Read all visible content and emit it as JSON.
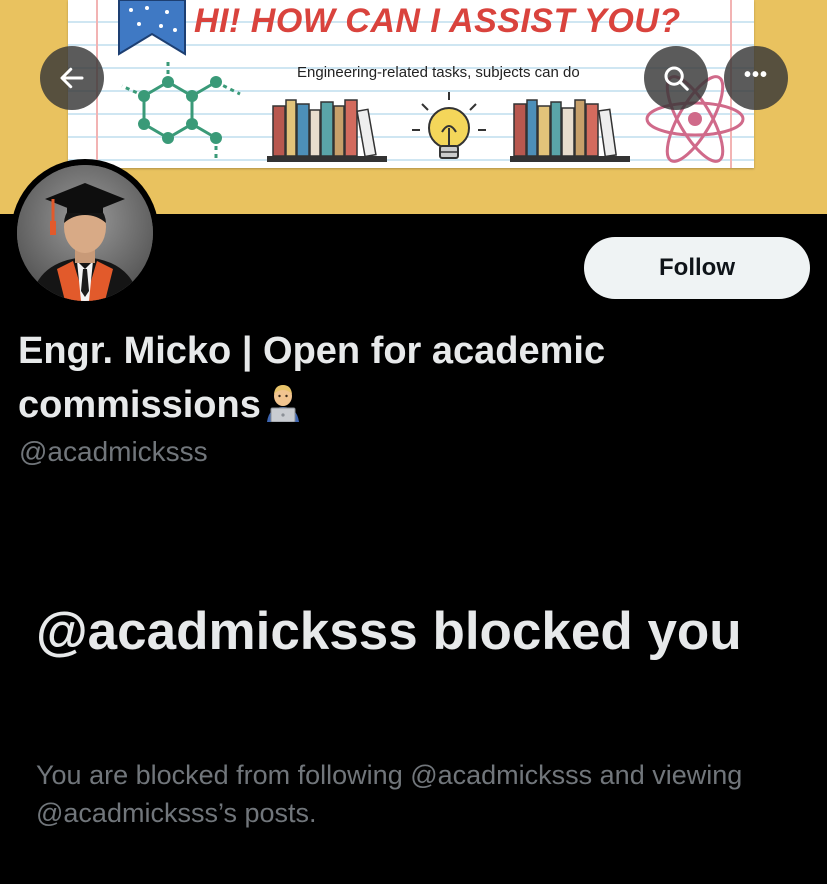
{
  "banner": {
    "headline": "HI! HOW CAN I ASSIST YOU?",
    "subtitle": "Engineering-related tasks, subjects can do"
  },
  "top_bar": {
    "back_icon": "arrow-left-icon",
    "search_icon": "search-icon",
    "more_icon": "more-horizontal-icon",
    "more_label": "•••"
  },
  "profile": {
    "display_name": "Engr. Micko | Open for academic commissions",
    "name_emoji": "technologist-emoji",
    "handle": "@acadmicksss",
    "follow_label": "Follow"
  },
  "blocked": {
    "title": "@acadmicksss blocked you",
    "description": "You are blocked from following @acadmicksss and viewing @acadmicksss’s posts."
  },
  "colors": {
    "background": "#000000",
    "primary_text": "#e7e9ea",
    "secondary_text": "#71767b",
    "follow_button_bg": "#eff3f4",
    "banner_accent": "#d9433d",
    "banner_yellow": "#e9c25f"
  }
}
